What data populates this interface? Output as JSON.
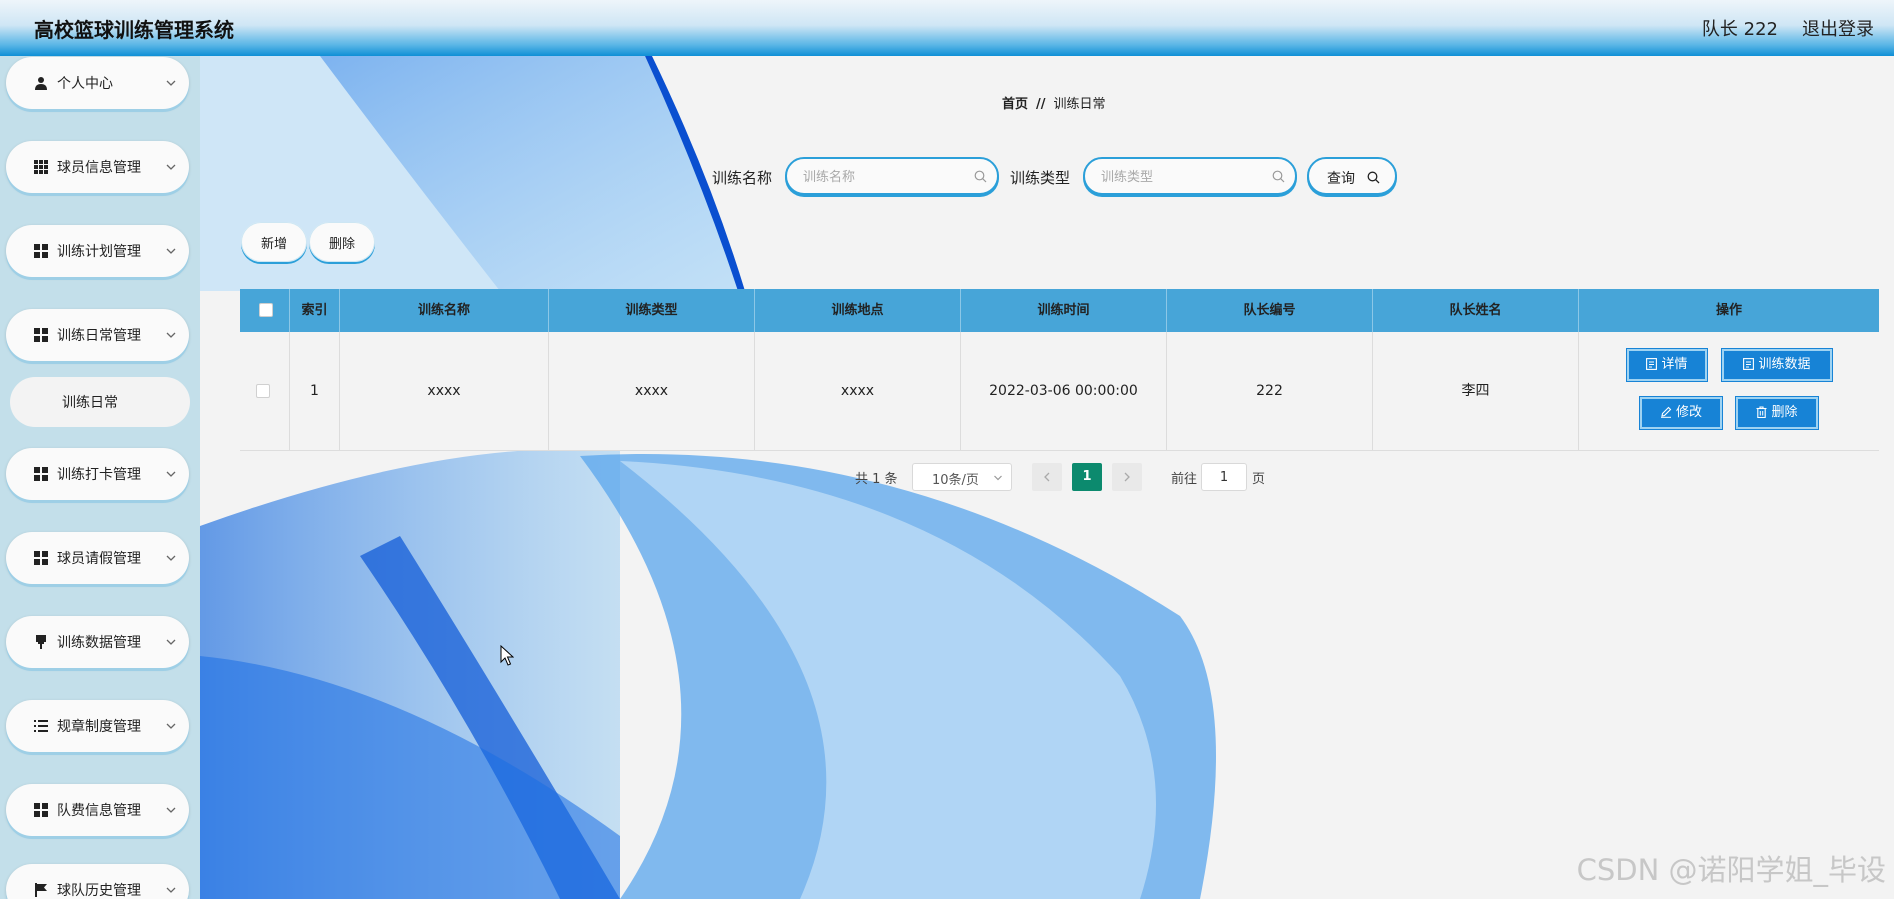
{
  "header": {
    "title": "高校篮球训练管理系统",
    "user": "队长 222",
    "logout": "退出登录"
  },
  "sidebar": {
    "items": [
      {
        "label": "个人中心",
        "icon": "user-icon"
      },
      {
        "label": "球员信息管理",
        "icon": "grid-icon"
      },
      {
        "label": "训练计划管理",
        "icon": "grid-icon"
      },
      {
        "label": "训练日常管理",
        "icon": "grid-icon"
      },
      {
        "label": "训练打卡管理",
        "icon": "grid-icon"
      },
      {
        "label": "球员请假管理",
        "icon": "grid-icon"
      },
      {
        "label": "训练数据管理",
        "icon": "pin-icon"
      },
      {
        "label": "规章制度管理",
        "icon": "list-icon"
      },
      {
        "label": "队费信息管理",
        "icon": "grid-icon"
      },
      {
        "label": "球队历史管理",
        "icon": "flag-icon"
      }
    ],
    "active_sub": "训练日常"
  },
  "breadcrumb": {
    "home": "首页",
    "separator": "//",
    "current": "训练日常"
  },
  "search": {
    "name_label": "训练名称",
    "name_placeholder": "训练名称",
    "name_value": "",
    "type_label": "训练类型",
    "type_placeholder": "训练类型",
    "type_value": "",
    "query_label": "查询"
  },
  "actions": {
    "add": "新增",
    "delete": "删除"
  },
  "table": {
    "headers": [
      "索引",
      "训练名称",
      "训练类型",
      "训练地点",
      "训练时间",
      "队长编号",
      "队长姓名",
      "操作"
    ],
    "rows": [
      {
        "index": "1",
        "name": "xxxx",
        "type": "xxxx",
        "location": "xxxx",
        "time": "2022-03-06 00:00:00",
        "captain_no": "222",
        "captain_name": "李四"
      }
    ],
    "ops": {
      "detail": "详情",
      "train_data": "训练数据",
      "edit": "修改",
      "delete": "删除"
    }
  },
  "pagination": {
    "total": "共 1 条",
    "page_size": "10条/页",
    "current": "1",
    "goto_label": "前往",
    "goto_value": "1",
    "suffix": "页"
  },
  "watermark": "CSDN @诺阳学姐_毕设",
  "colors": {
    "header_blue": "#0f8fd6",
    "table_head": "#47a5d8",
    "op_button": "#1783d6",
    "active_page": "#0c8a6e"
  }
}
